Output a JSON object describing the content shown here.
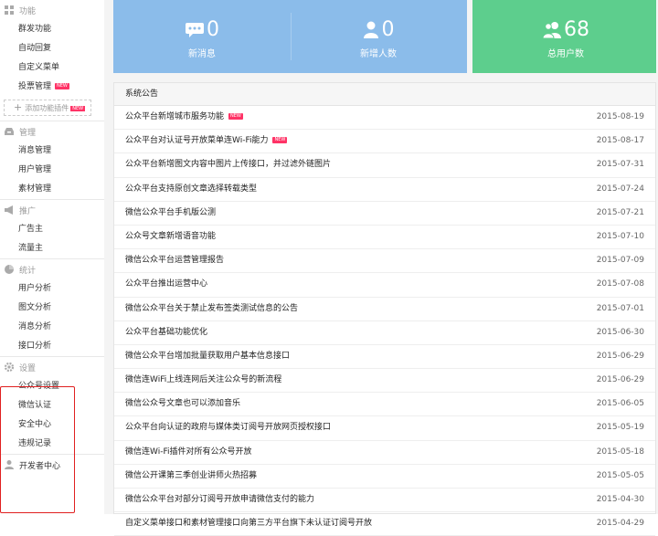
{
  "sidebar": {
    "sections": [
      {
        "title": "功能",
        "icon": "grid-icon",
        "items": [
          {
            "label": "群发功能"
          },
          {
            "label": "自动回复"
          },
          {
            "label": "自定义菜单"
          },
          {
            "label": "投票管理",
            "badge": "NEW"
          }
        ]
      },
      {
        "title": "管理",
        "icon": "inbox-icon",
        "items": [
          {
            "label": "消息管理"
          },
          {
            "label": "用户管理"
          },
          {
            "label": "素材管理"
          }
        ]
      },
      {
        "title": "推广",
        "icon": "megaphone-icon",
        "items": [
          {
            "label": "广告主"
          },
          {
            "label": "流量主"
          }
        ]
      },
      {
        "title": "统计",
        "icon": "pie-chart-icon",
        "items": [
          {
            "label": "用户分析"
          },
          {
            "label": "图文分析"
          },
          {
            "label": "消息分析"
          },
          {
            "label": "接口分析"
          }
        ]
      },
      {
        "title": "设置",
        "icon": "gear-icon",
        "items": [
          {
            "label": "公众号设置"
          },
          {
            "label": "微信认证"
          },
          {
            "label": "安全中心"
          },
          {
            "label": "违规记录"
          }
        ]
      }
    ],
    "add_plugin": {
      "label": "添加功能插件",
      "badge": "NEW"
    },
    "developer": {
      "label": "开发者中心",
      "icon": "user-icon"
    }
  },
  "stats": {
    "new_messages": {
      "value": "0",
      "label": "新消息",
      "icon": "chat-bubble-icon"
    },
    "new_users": {
      "value": "0",
      "label": "新增人数",
      "icon": "person-icon"
    },
    "total_users": {
      "value": "68",
      "label": "总用户数",
      "icon": "group-icon"
    }
  },
  "announcements": {
    "title": "系统公告",
    "items": [
      {
        "title": "公众平台新增城市服务功能",
        "date": "2015-08-19",
        "badge": "NEW"
      },
      {
        "title": "公众平台对认证号开放菜单连Wi-Fi能力",
        "date": "2015-08-17",
        "badge": "NEW"
      },
      {
        "title": "公众平台新增图文内容中图片上传接口，并过滤外链图片",
        "date": "2015-07-31"
      },
      {
        "title": "公众平台支持原创文章选择转载类型",
        "date": "2015-07-24"
      },
      {
        "title": "微信公众平台手机版公测",
        "date": "2015-07-21"
      },
      {
        "title": "公众号文章新增语音功能",
        "date": "2015-07-10"
      },
      {
        "title": "微信公众平台运营管理报告",
        "date": "2015-07-09"
      },
      {
        "title": "公众平台推出运营中心",
        "date": "2015-07-08"
      },
      {
        "title": "微信公众平台关于禁止发布签类测试信息的公告",
        "date": "2015-07-01"
      },
      {
        "title": "公众平台基础功能优化",
        "date": "2015-06-30"
      },
      {
        "title": "微信公众平台增加批量获取用户基本信息接口",
        "date": "2015-06-29"
      },
      {
        "title": "微信连WiFi上线连网后关注公众号的新流程",
        "date": "2015-06-29"
      },
      {
        "title": "微信公众号文章也可以添加音乐",
        "date": "2015-06-05"
      },
      {
        "title": "公众平台向认证的政府与媒体类订阅号开放网页授权接口",
        "date": "2015-05-19"
      },
      {
        "title": "微信连Wi-Fi插件对所有公众号开放",
        "date": "2015-05-18"
      },
      {
        "title": "微信公开课第三季创业讲师火热招募",
        "date": "2015-05-05"
      },
      {
        "title": "微信公众平台对部分订阅号开放申请微信支付的能力",
        "date": "2015-04-30"
      },
      {
        "title": "自定义菜单接口和素材管理接口向第三方平台旗下未认证订阅号开放",
        "date": "2015-04-29"
      }
    ]
  },
  "colors": {
    "blue_card": "#8bbcea",
    "green_card": "#5dce8d",
    "highlight_border": "#e02020",
    "badge": "#ff3366"
  }
}
